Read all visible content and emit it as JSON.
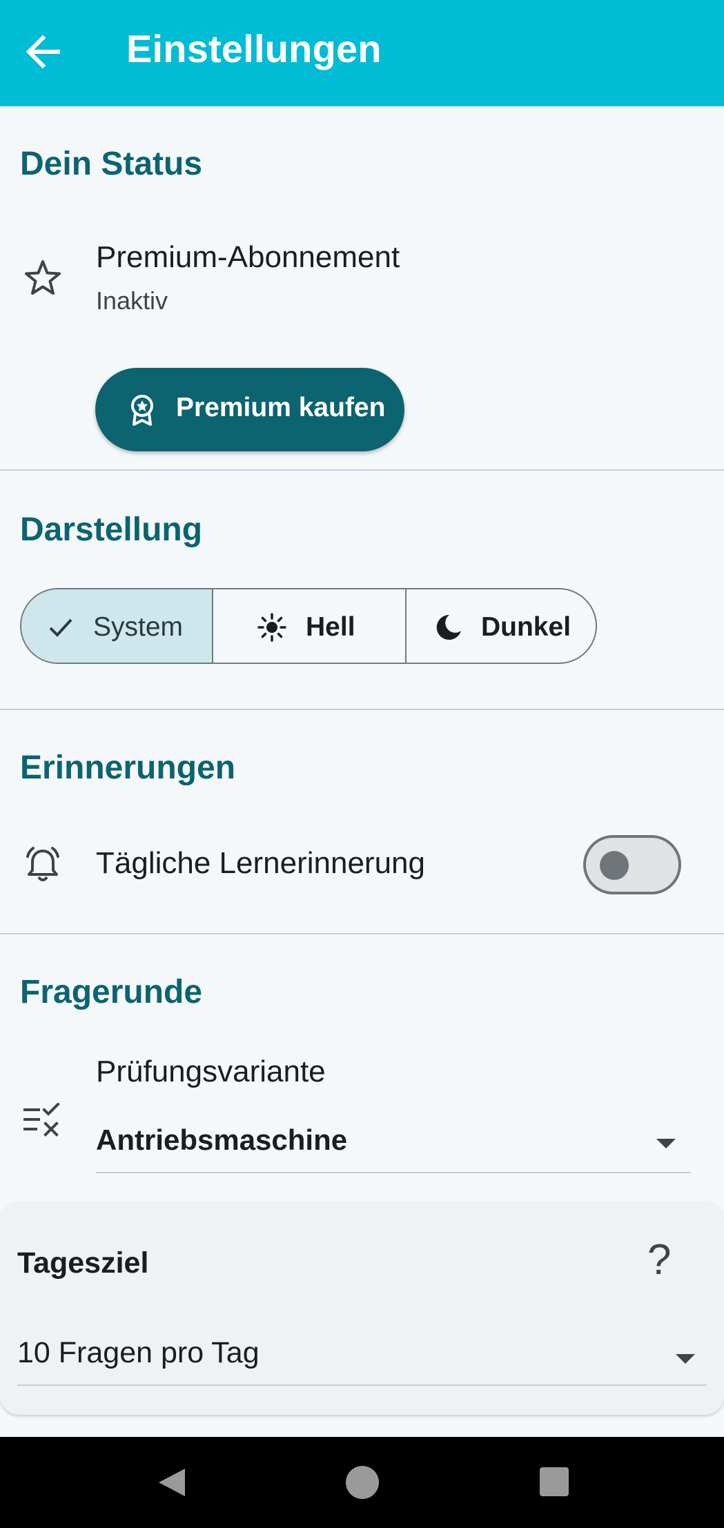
{
  "appbar": {
    "title": "Einstellungen",
    "back_icon": "arrow-left-icon",
    "background": "#00bcd4"
  },
  "status": {
    "heading": "Dein Status",
    "premium": {
      "icon": "star-outline-icon",
      "title": "Premium-Abonnement",
      "subtitle": "Inaktiv"
    },
    "buy_button": {
      "icon": "award-badge-icon",
      "label": "Premium kaufen"
    }
  },
  "appearance": {
    "heading": "Darstellung",
    "options": [
      {
        "label": "System",
        "icon": "check-icon",
        "selected": true
      },
      {
        "label": "Hell",
        "icon": "sun-icon",
        "selected": false
      },
      {
        "label": "Dunkel",
        "icon": "moon-icon",
        "selected": false
      }
    ]
  },
  "reminders": {
    "heading": "Erinnerungen",
    "daily": {
      "icon": "alarm-bell-icon",
      "label": "Tägliche Lernerinnerung",
      "enabled": false
    }
  },
  "quiz": {
    "heading": "Fragerunde",
    "variant": {
      "icon": "checklist-icon",
      "label": "Prüfungsvariante",
      "value": "Antriebsmaschine"
    }
  },
  "daily_goal": {
    "title": "Tagesziel",
    "help": "?",
    "value": "10 Fragen pro Tag"
  },
  "colors": {
    "accent": "#0b6470",
    "appbar": "#00bcd4",
    "selected_segment": "#cde7ec"
  }
}
